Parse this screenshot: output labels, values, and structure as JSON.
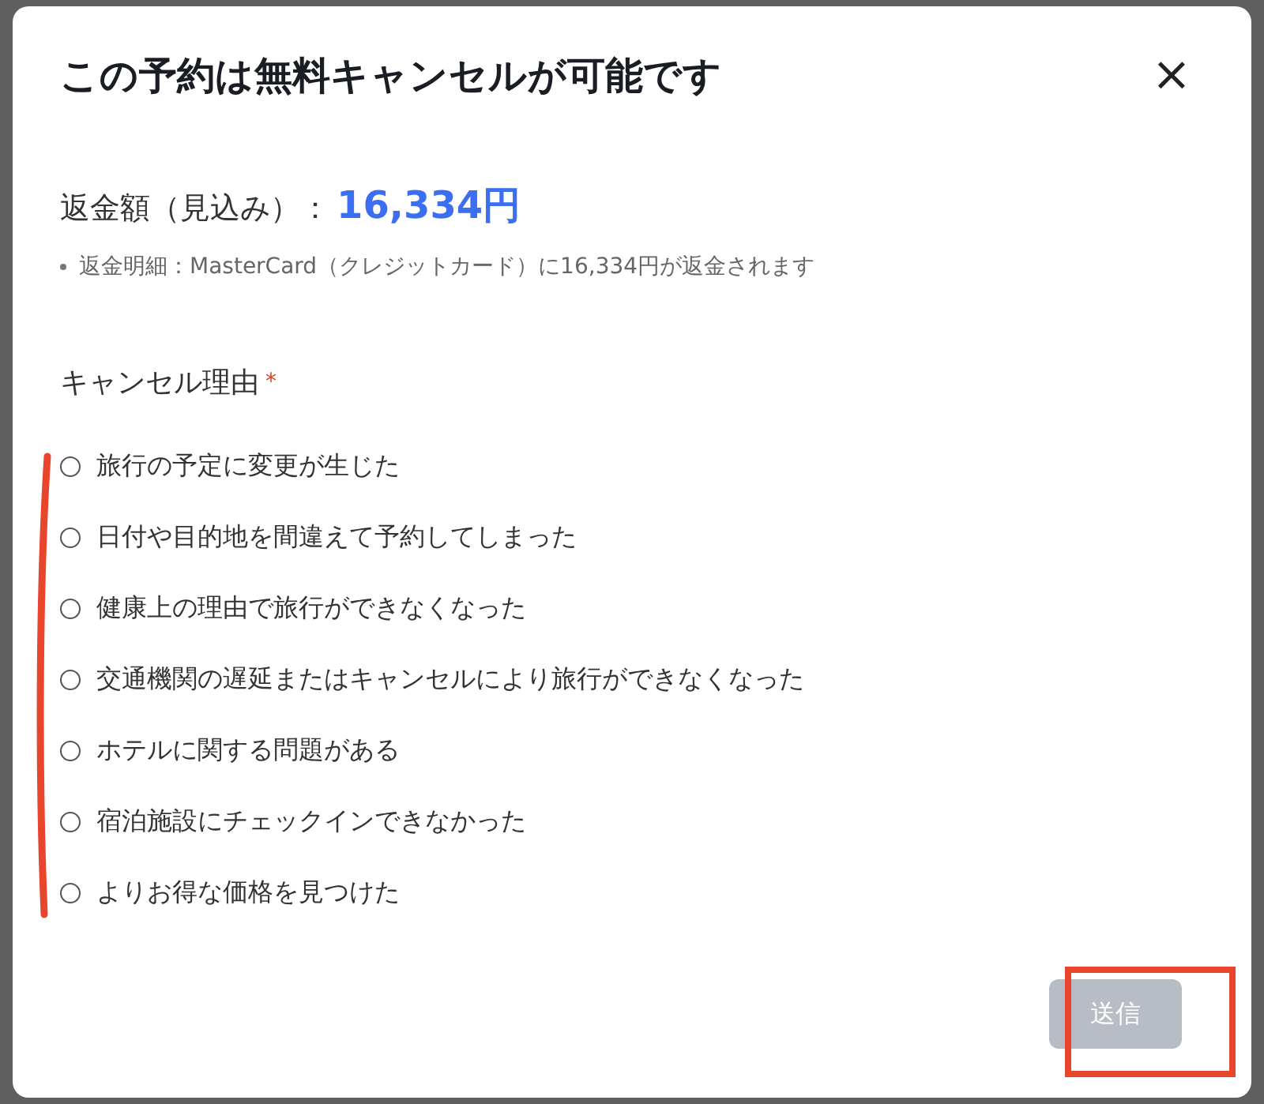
{
  "dialog": {
    "title": "この予約は無料キャンセルが可能です",
    "close": "×"
  },
  "refund": {
    "label": "返金額（見込み）：",
    "amount": "16,334円",
    "detail": "返金明細：MasterCard（クレジットカード）に16,334円が返金されます"
  },
  "reasons": {
    "label": "キャンセル理由",
    "required_mark": "*",
    "options": [
      {
        "label": "旅行の予定に変更が生じた",
        "selected": false
      },
      {
        "label": "日付や目的地を間違えて予約してしまった",
        "selected": false
      },
      {
        "label": "健康上の理由で旅行ができなくなった",
        "selected": false
      },
      {
        "label": "交通機関の遅延またはキャンセルにより旅行ができなくなった",
        "selected": false
      },
      {
        "label": "ホテルに関する問題がある",
        "selected": false
      },
      {
        "label": "宿泊施設にチェックインできなかった",
        "selected": false
      },
      {
        "label": "よりお得な価格を見つけた",
        "selected": false
      }
    ]
  },
  "submit": {
    "label": "送信",
    "disabled": true
  }
}
